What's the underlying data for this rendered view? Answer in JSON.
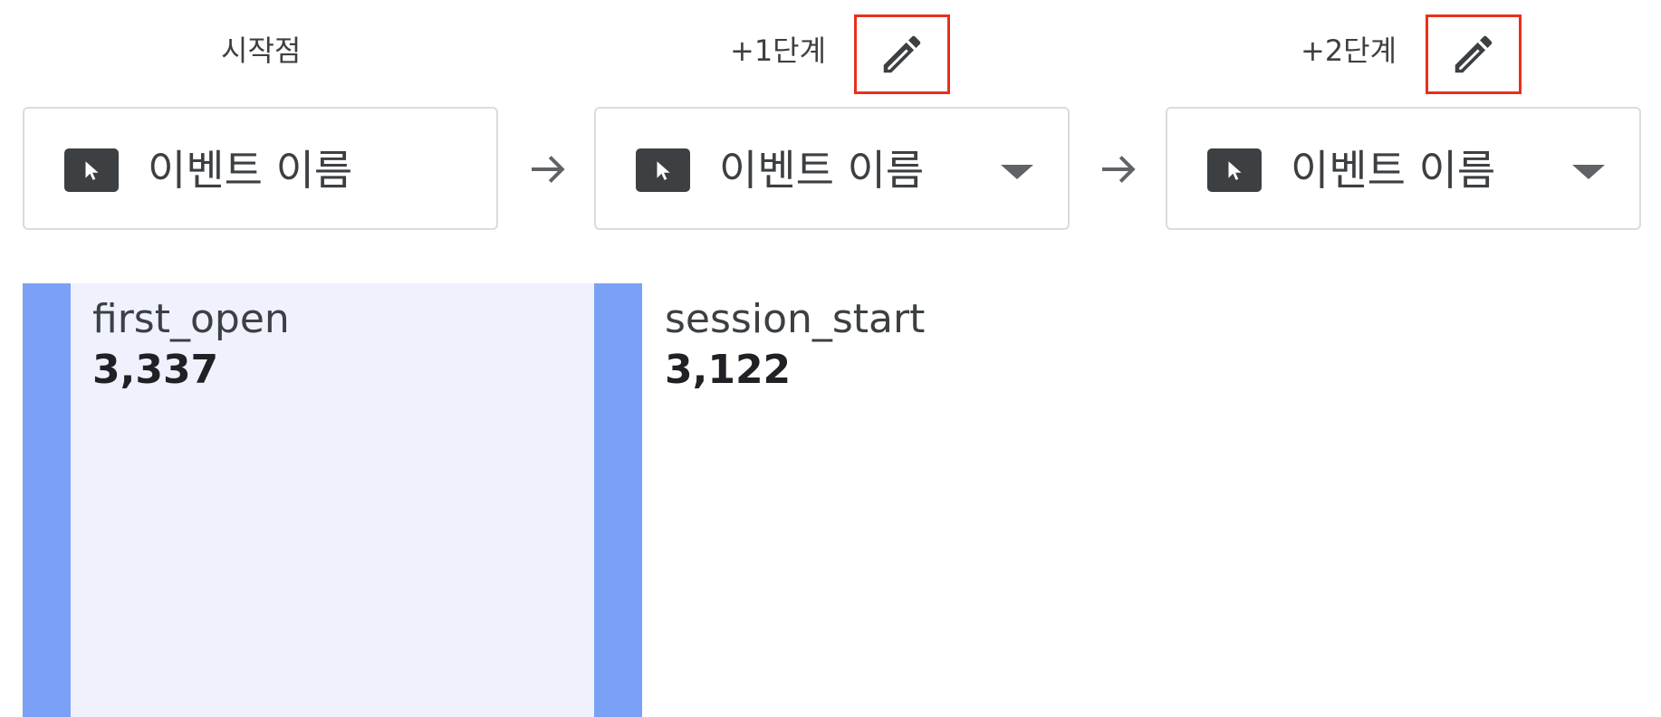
{
  "steps": [
    {
      "header": "시작점",
      "label": "이벤트 이름",
      "icon": "cursor-icon",
      "has_dropdown": false,
      "has_edit": false
    },
    {
      "header": "+1단계",
      "label": "이벤트 이름",
      "icon": "cursor-icon",
      "has_dropdown": true,
      "has_edit": true
    },
    {
      "header": "+2단계",
      "label": "이벤트 이름",
      "icon": "cursor-icon",
      "has_dropdown": true,
      "has_edit": true
    }
  ],
  "nodes": [
    {
      "name": "first_open",
      "count": "3,337"
    },
    {
      "name": "session_start",
      "count": "3,122"
    }
  ],
  "colors": {
    "highlight_border": "#e8301c",
    "bar": "#7aa1f5",
    "selected_panel": "#eff2fd",
    "icon_bg": "#3c4043"
  }
}
